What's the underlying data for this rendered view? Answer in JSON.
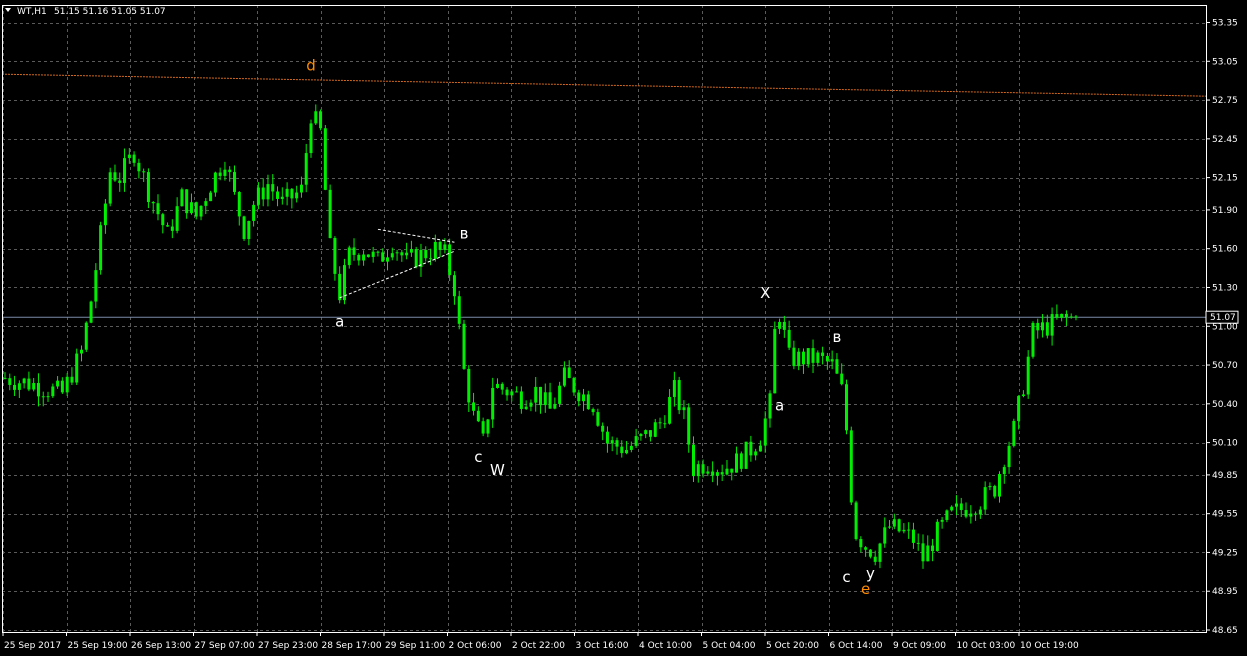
{
  "window": {
    "symbol": "WT,H1",
    "ohlc": "51.15 51.16 51.05 51.07"
  },
  "colors": {
    "background": "#000000",
    "grid": "#5a5a5a",
    "axis": "#ffffff",
    "candle": "#00ee00",
    "bid_line": "#7a8aa8",
    "ma_line": "#d2691e",
    "wave_white": "#ffffff",
    "wave_orange": "#ff8c00",
    "price_label_bg": "#000000"
  },
  "chart_data": {
    "type": "candlestick",
    "timeframe": "H1",
    "grid": true,
    "ylim": [
      48.65,
      53.35
    ],
    "y_ticks": [
      "53.35",
      "53.05",
      "52.75",
      "52.45",
      "52.15",
      "51.90",
      "51.60",
      "51.30",
      "51.00",
      "50.70",
      "50.40",
      "50.10",
      "49.85",
      "49.55",
      "49.25",
      "48.95",
      "48.65"
    ],
    "x_ticks": [
      "25 Sep 2017",
      "25 Sep 19:00",
      "26 Sep 13:00",
      "27 Sep 07:00",
      "27 Sep 23:00",
      "28 Sep 17:00",
      "29 Sep 11:00",
      "2 Oct 06:00",
      "2 Oct 22:00",
      "3 Oct 16:00",
      "4 Oct 10:00",
      "5 Oct 04:00",
      "5 Oct 20:00",
      "6 Oct 14:00",
      "9 Oct 09:00",
      "10 Oct 03:00",
      "10 Oct 19:00"
    ],
    "current_price": "51.07",
    "price_path": [
      [
        0,
        50.6
      ],
      [
        6,
        50.55
      ],
      [
        12,
        50.48
      ],
      [
        16,
        50.8
      ],
      [
        18,
        51.2
      ],
      [
        20,
        51.7
      ],
      [
        22,
        52.2
      ],
      [
        24,
        52.15
      ],
      [
        27,
        52.35
      ],
      [
        30,
        52.05
      ],
      [
        34,
        51.7
      ],
      [
        37,
        52.0
      ],
      [
        40,
        51.85
      ],
      [
        43,
        52.1
      ],
      [
        46,
        52.3
      ],
      [
        48,
        52.0
      ],
      [
        50,
        51.75
      ],
      [
        52,
        51.95
      ],
      [
        55,
        52.1
      ],
      [
        58,
        51.95
      ],
      [
        62,
        52.05
      ],
      [
        64,
        52.65
      ],
      [
        66,
        52.5
      ],
      [
        68,
        51.6
      ],
      [
        70,
        51.25
      ],
      [
        72,
        51.55
      ],
      [
        75,
        51.6
      ],
      [
        78,
        51.5
      ],
      [
        81,
        51.65
      ],
      [
        84,
        51.5
      ],
      [
        87,
        51.55
      ],
      [
        90,
        51.6
      ],
      [
        92,
        51.55
      ],
      [
        94,
        51.3
      ],
      [
        96,
        50.65
      ],
      [
        98,
        50.3
      ],
      [
        100,
        50.1
      ],
      [
        102,
        50.55
      ],
      [
        105,
        50.5
      ],
      [
        108,
        50.45
      ],
      [
        111,
        50.5
      ],
      [
        114,
        50.35
      ],
      [
        117,
        50.6
      ],
      [
        120,
        50.5
      ],
      [
        123,
        50.4
      ],
      [
        126,
        50.1
      ],
      [
        130,
        50.05
      ],
      [
        134,
        50.15
      ],
      [
        137,
        50.25
      ],
      [
        140,
        50.5
      ],
      [
        142,
        50.3
      ],
      [
        144,
        49.9
      ],
      [
        147,
        49.95
      ],
      [
        150,
        49.9
      ],
      [
        153,
        49.95
      ],
      [
        156,
        50.05
      ],
      [
        158,
        50.15
      ],
      [
        160,
        50.4
      ],
      [
        161,
        50.95
      ],
      [
        162,
        51.1
      ],
      [
        164,
        50.75
      ],
      [
        167,
        50.75
      ],
      [
        170,
        50.75
      ],
      [
        173,
        50.7
      ],
      [
        175,
        50.5
      ],
      [
        176,
        50.2
      ],
      [
        177,
        49.7
      ],
      [
        178,
        49.4
      ],
      [
        180,
        49.3
      ],
      [
        182,
        49.25
      ],
      [
        185,
        49.45
      ],
      [
        188,
        49.4
      ],
      [
        190,
        49.35
      ],
      [
        192,
        49.2
      ],
      [
        195,
        49.4
      ],
      [
        198,
        49.55
      ],
      [
        201,
        49.6
      ],
      [
        204,
        49.65
      ],
      [
        207,
        49.75
      ],
      [
        209,
        50.0
      ],
      [
        211,
        50.2
      ],
      [
        213,
        50.55
      ],
      [
        215,
        50.95
      ],
      [
        218,
        51.0
      ],
      [
        221,
        51.05
      ],
      [
        224,
        51.07
      ]
    ],
    "ma_path": [
      [
        0,
        52.95
      ],
      [
        224,
        52.78
      ]
    ],
    "triangle": {
      "upper": [
        [
          78,
          51.75
        ],
        [
          94,
          51.65
        ]
      ],
      "lower": [
        [
          70,
          51.22
        ],
        [
          94,
          51.58
        ]
      ]
    },
    "wave_labels": [
      {
        "text": "d",
        "x": 64,
        "y": 52.98,
        "color": "orange"
      },
      {
        "text": "a",
        "x": 70,
        "y": 51.0,
        "color": "white"
      },
      {
        "text": "в",
        "x": 96,
        "y": 51.68,
        "color": "white"
      },
      {
        "text": "c",
        "x": 99,
        "y": 49.95,
        "color": "white"
      },
      {
        "text": "W",
        "x": 103,
        "y": 49.85,
        "color": "white"
      },
      {
        "text": "X",
        "x": 159,
        "y": 51.22,
        "color": "white"
      },
      {
        "text": "a",
        "x": 162,
        "y": 50.35,
        "color": "white"
      },
      {
        "text": "в",
        "x": 174,
        "y": 50.88,
        "color": "white"
      },
      {
        "text": "c",
        "x": 176,
        "y": 49.02,
        "color": "white"
      },
      {
        "text": "y",
        "x": 181,
        "y": 49.05,
        "color": "white"
      },
      {
        "text": "e",
        "x": 180,
        "y": 48.93,
        "color": "orange"
      }
    ]
  }
}
